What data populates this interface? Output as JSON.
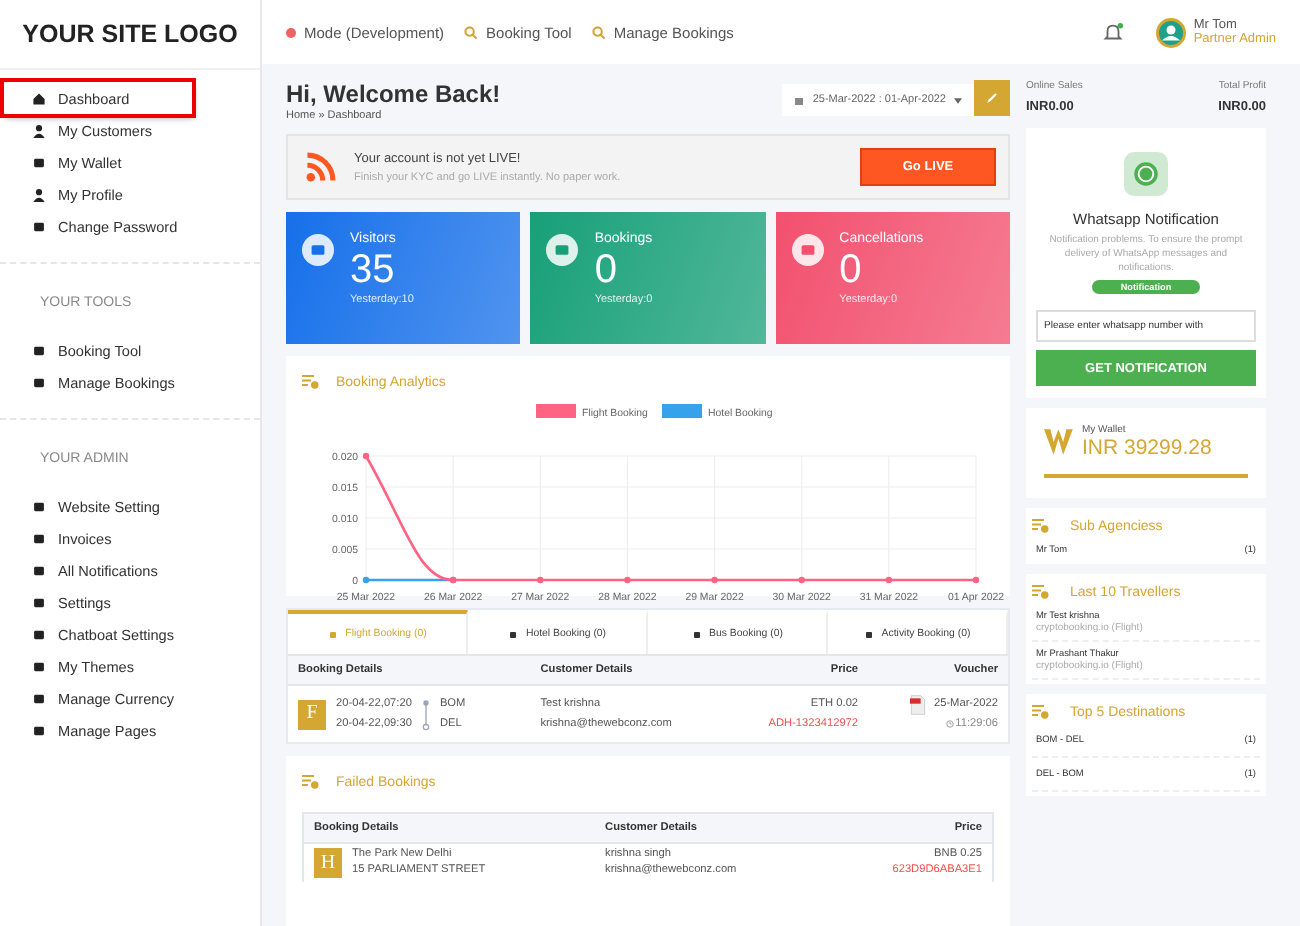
{
  "sidebar": {
    "logo": "YOUR SITE LOGO",
    "groups": [
      {
        "items": [
          {
            "label": "Dashboard",
            "selected": true
          },
          {
            "label": "My Customers",
            "selected": false
          },
          {
            "label": "My Wallet",
            "selected": false
          },
          {
            "label": "My Profile",
            "selected": false
          },
          {
            "label": "Change Password",
            "selected": false
          }
        ]
      },
      {
        "heading": "YOUR TOOLS",
        "items": [
          {
            "label": "Booking Tool",
            "selected": false
          },
          {
            "label": "Manage Bookings",
            "selected": false
          }
        ]
      },
      {
        "heading": "YOUR ADMIN",
        "items": [
          {
            "label": "Website Setting",
            "selected": false
          },
          {
            "label": "Invoices",
            "selected": false
          },
          {
            "label": "All Notifications",
            "selected": false
          },
          {
            "label": "Settings",
            "selected": false
          },
          {
            "label": "Chatboat Settings",
            "selected": false
          },
          {
            "label": "My Themes",
            "selected": false
          },
          {
            "label": "Manage Currency",
            "selected": false
          },
          {
            "label": "Manage Pages",
            "selected": false
          }
        ]
      }
    ]
  },
  "topbar": {
    "mode": "Mode (Development)",
    "links": [
      "Booking Tool",
      "Manage Bookings"
    ],
    "user": {
      "name": "Mr Tom",
      "role": "Partner Admin"
    }
  },
  "page": {
    "title": "Hi, Welcome Back!",
    "breadcrumb": "Home » Dashboard",
    "date_range": "25-Mar-2022 : 01-Apr-2022"
  },
  "alert": {
    "title": "Your account is not yet LIVE!",
    "text": "Finish your KYC and go LIVE instantly. No paper work.",
    "button": "Go LIVE"
  },
  "stats": [
    {
      "label": "Visitors",
      "value": "35",
      "yesterday": "Yesterday:10",
      "color": "#1670ea"
    },
    {
      "label": "Bookings",
      "value": "0",
      "yesterday": "Yesterday:0",
      "color": "#17a078"
    },
    {
      "label": "Cancellations",
      "value": "0",
      "yesterday": "Yesterday:0",
      "color": "#f2506e"
    }
  ],
  "analytics": {
    "title": "Booking Analytics",
    "chart_data": {
      "type": "line",
      "grid": true,
      "legend": true,
      "categories": [
        "25 Mar 2022",
        "26 Mar 2022",
        "27 Mar 2022",
        "28 Mar 2022",
        "29 Mar 2022",
        "30 Mar 2022",
        "31 Mar 2022",
        "01 Apr 2022"
      ],
      "ylim": [
        0,
        0.02
      ],
      "yticks": [
        {
          "value": 0,
          "label": "0"
        },
        {
          "value": 0.005,
          "label": "0.005"
        },
        {
          "value": 0.01,
          "label": "0.010"
        },
        {
          "value": 0.015,
          "label": "0.015"
        },
        {
          "value": 0.02,
          "label": "0.020"
        }
      ],
      "series": [
        {
          "name": "Flight Booking",
          "color": "#ff6384",
          "marker": true,
          "values": [
            0.02,
            0,
            0,
            0,
            0,
            0,
            0,
            0
          ]
        },
        {
          "name": "Hotel Booking",
          "color": "#36a2eb",
          "marker": true,
          "values": [
            0,
            0,
            null,
            null,
            null,
            null,
            null,
            null
          ]
        }
      ]
    }
  },
  "bookings": {
    "tabs": [
      {
        "label": "Flight Booking (0)",
        "selected": true
      },
      {
        "label": "Hotel Booking (0)",
        "selected": false
      },
      {
        "label": "Bus Booking (0)",
        "selected": false
      },
      {
        "label": "Activity Booking (0)",
        "selected": false
      }
    ],
    "columns": [
      "Booking Details",
      "Customer Details",
      "Price",
      "Voucher"
    ],
    "rows": [
      {
        "initial": "F",
        "depart": "20-04-22,07:20",
        "arrive": "20-04-22,09:30",
        "from": "BOM",
        "to": "DEL",
        "customer": "Test krishna",
        "email": "krishna@thewebconz.com",
        "price": "ETH 0.02",
        "ref": "ADH-1323412972",
        "date": "25-Mar-2022",
        "time": "11:29:06"
      }
    ]
  },
  "failed": {
    "title": "Failed Bookings",
    "columns": [
      "Booking Details",
      "Customer Details",
      "Price"
    ],
    "rows": [
      {
        "initial": "H",
        "name": "The Park New Delhi",
        "address": "15 PARLIAMENT STREET",
        "customer": "krishna singh",
        "email": "krishna@thewebconz.com",
        "price": "BNB 0.25",
        "ref": "623D9D6ABA3E1"
      }
    ]
  },
  "right": {
    "totals": [
      {
        "label": "Online Sales",
        "value": "INR0.00"
      },
      {
        "label": "Total Profit",
        "value": "INR0.00"
      }
    ],
    "whatsapp": {
      "title": "Whatsapp Notification",
      "text": "Notification problems. To ensure the prompt delivery of WhatsApp messages and notifications.",
      "badge": "Notification",
      "placeholder": "Please enter whatsapp number with",
      "button": "GET NOTIFICATION"
    },
    "wallet": {
      "label": "My Wallet",
      "amount": "INR 39299.28"
    },
    "sub_agencies": {
      "title": "Sub Agenciess",
      "items": [
        {
          "name": "Mr Tom",
          "count": "(1)"
        }
      ]
    },
    "travellers": {
      "title": "Last 10 Travellers",
      "items": [
        {
          "name": "Mr Test krishna",
          "source": "cryptobooking.io (Flight)"
        },
        {
          "name": "Mr Prashant Thakur",
          "source": "cryptobooking.io (Flight)"
        }
      ]
    },
    "destinations": {
      "title": "Top 5 Destinations",
      "items": [
        {
          "route": "BOM - DEL",
          "count": "(1)"
        },
        {
          "route": "DEL - BOM",
          "count": "(1)"
        }
      ]
    }
  }
}
